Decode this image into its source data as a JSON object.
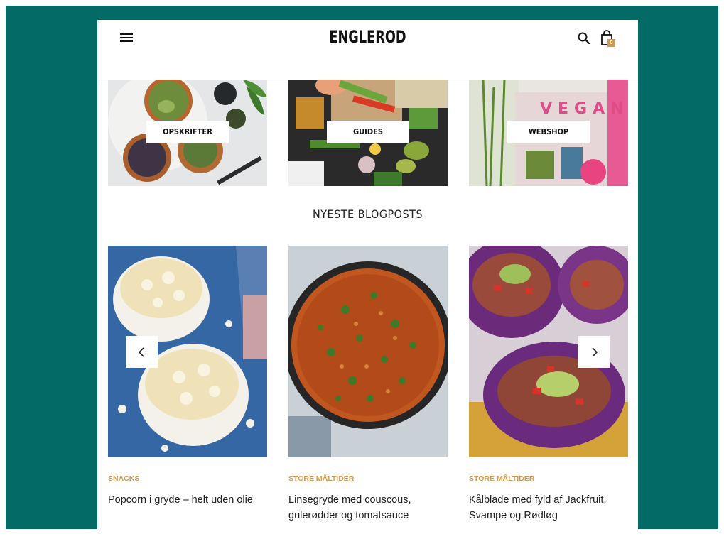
{
  "site": {
    "logo": "ENGLEROD"
  },
  "header": {
    "cart_count": "0"
  },
  "categories": [
    {
      "label": "OPSKRIFTER"
    },
    {
      "label": "GUIDES"
    },
    {
      "label": "WEBSHOP"
    }
  ],
  "section": {
    "title": "NYESTE BLOGPOSTS"
  },
  "posts": [
    {
      "category": "SNACKS",
      "title": "Popcorn i gryde – helt uden olie"
    },
    {
      "category": "STORE MÅLTIDER",
      "title": "Linsegryde med couscous, gulerødder og tomatsauce"
    },
    {
      "category": "STORE MÅLTIDER",
      "title": "Kålblade med fyld af Jackfruit, Svampe og Rødløg"
    }
  ],
  "webshop_book": {
    "cover_title": "VEGANSK"
  },
  "colors": {
    "frame": "#036a66",
    "accent": "#d39a4f"
  },
  "icons": [
    "menu-icon",
    "search-icon",
    "cart-icon",
    "chevron-left-icon",
    "chevron-right-icon"
  ]
}
